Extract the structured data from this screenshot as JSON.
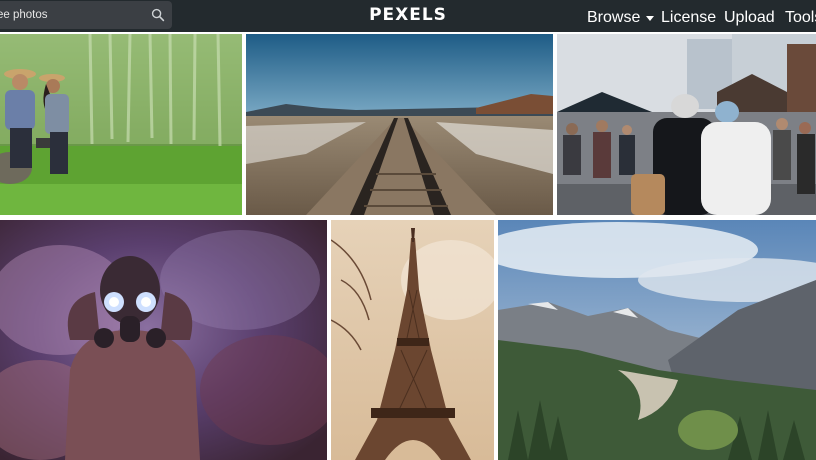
{
  "header": {
    "search": {
      "placeholder": "ee photos",
      "value": ""
    },
    "logo": "PEXELS",
    "nav": [
      {
        "label": "Browse",
        "icon": "chevron-down-icon"
      },
      {
        "label": "License"
      },
      {
        "label": "Upload"
      },
      {
        "label": "Tools"
      }
    ]
  },
  "colors": {
    "topbar": "#232a2e",
    "search_bg": "#3b3f44",
    "text": "#ffffff"
  },
  "gallery": {
    "photos": [
      {
        "subject": "couple in green field"
      },
      {
        "subject": "railway tracks in desert"
      },
      {
        "subject": "people at outdoor market"
      },
      {
        "subject": "person in gas mask with smoke"
      },
      {
        "subject": "eiffel tower"
      },
      {
        "subject": "mountain valley"
      }
    ]
  }
}
